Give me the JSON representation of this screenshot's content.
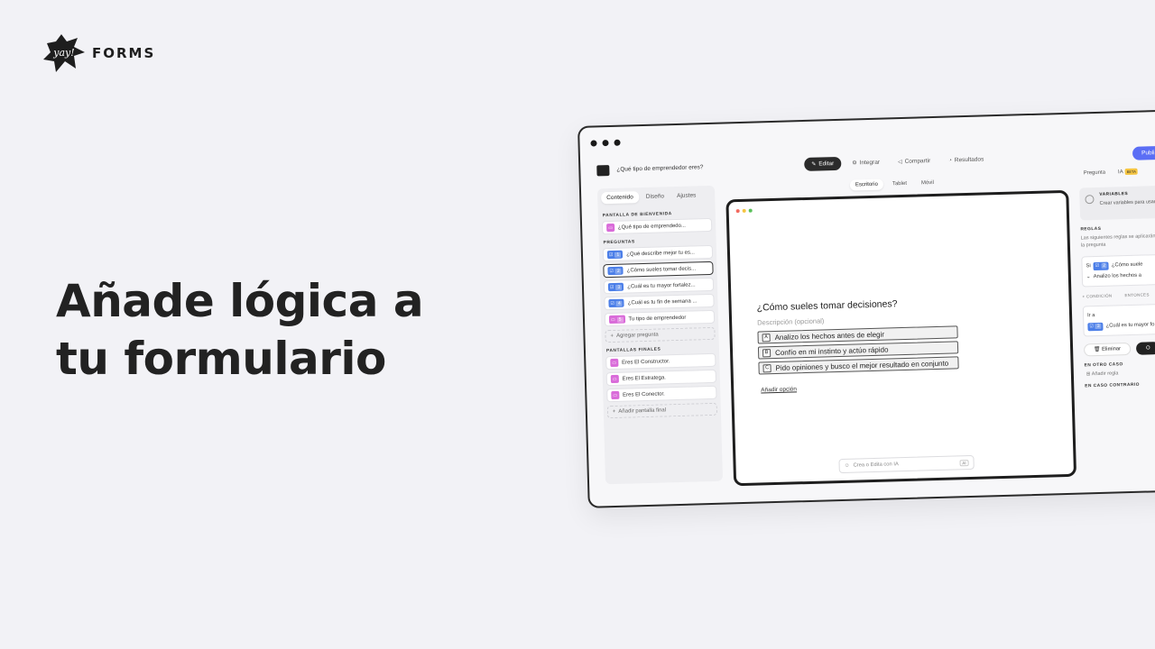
{
  "brand": {
    "logo_script": "yay!",
    "word": "FORMS"
  },
  "headline": {
    "line1": "Añade lógica a",
    "line2": "tu formulario"
  },
  "app": {
    "form_title": "¿Qué tipo de emprendedor eres?",
    "top_tabs": [
      {
        "label": "Editar",
        "icon": "pencil-icon"
      },
      {
        "label": "Integrar",
        "icon": "integrations-icon"
      },
      {
        "label": "Compartir",
        "icon": "share-icon"
      },
      {
        "label": "Resultados",
        "icon": "results-icon"
      }
    ],
    "publish_label": "Publi",
    "sidebar": {
      "tabs": [
        "Contenido",
        "Diseño",
        "Ajustes"
      ],
      "welcome_label": "PANTALLA DE BIENVENIDA",
      "welcome_item": "¿Qué tipo de emprendedo...",
      "questions_label": "PREGUNTAS",
      "questions": [
        {
          "n": "1",
          "text": "¿Qué describe mejor tu es..."
        },
        {
          "n": "2",
          "text": "¿Cómo sueles tomar decis..."
        },
        {
          "n": "3",
          "text": "¿Cuál es tu mayor fortalez..."
        },
        {
          "n": "4",
          "text": "¿Cuál es tu fin de semana ..."
        },
        {
          "n": "5",
          "text": "Tu tipo de emprendedor"
        }
      ],
      "add_question": "Agregar pregunta",
      "endings_label": "PANTALLAS FINALES",
      "endings": [
        "Eres El Constructor.",
        "Eres El Estratega.",
        "Eres El Conector."
      ],
      "add_ending": "Añadir pantalla final"
    },
    "view_tabs": [
      "Escritorio",
      "Tablet",
      "Móvil"
    ],
    "canvas": {
      "question": "¿Cómo sueles tomar decisiones?",
      "description": "Descripción (opcional)",
      "options": [
        {
          "key": "A",
          "text": "Analizo los hechos antes de elegir"
        },
        {
          "key": "B",
          "text": "Confío en mi instinto y actúo rápido"
        },
        {
          "key": "C",
          "text": "Pido opiniones y busco el mejor resultado en conjunto"
        }
      ],
      "add_option": "Añadir opción",
      "ai_placeholder": "Crea o Edita con IA",
      "ai_badge": "AI"
    },
    "right_panel": {
      "tabs": [
        "Pregunta",
        "IA"
      ],
      "beta": "BETA",
      "variables_title": "VARIABLES",
      "variables_desc": "Crear variables para usar en tus reglas lógicas.",
      "rules_label": "REGLAS",
      "rules_desc": "Las siguientes reglas se aplicarán cuando alguien responda la pregunta",
      "rule_if": "Si",
      "rule_q_num": "2",
      "rule_q_text": "¿Cómo suele",
      "rule_value": "Analizo los hechos a",
      "cond_label": "+ CONDICIÓN",
      "then_label": "ENTONCES",
      "goto_label": "Ir a",
      "goto_q_num": "3",
      "goto_q_text": "¿Cuál es tu mayor fo",
      "delete_label": "Eliminar",
      "otherwise_label": "EN OTRO CASO",
      "add_rule": "Añadir regla",
      "else_label": "EN CASO CONTRARIO"
    }
  }
}
